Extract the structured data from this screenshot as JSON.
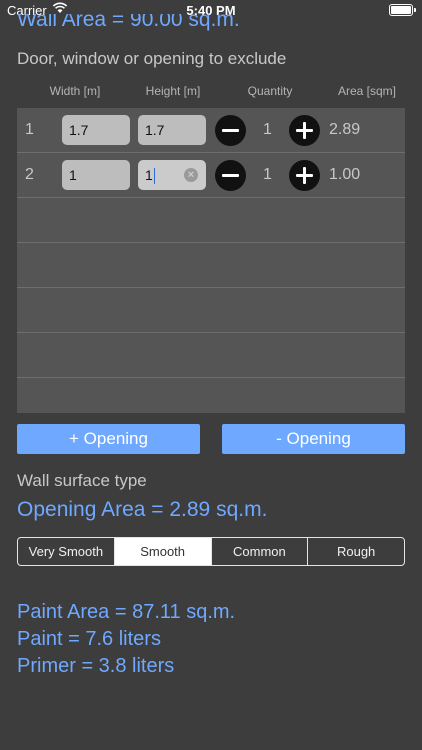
{
  "status_bar": {
    "carrier": "Carrier",
    "time": "5:40 PM"
  },
  "wall_area": "Wall Area = 90.00 sq.m.",
  "openings_section": {
    "title": "Door, window or opening to exclude",
    "columns": [
      "Width [m]",
      "Height [m]",
      "Quantity",
      "Area [sqm]"
    ],
    "rows": [
      {
        "num": "1",
        "width": "1.7",
        "height": "1.7",
        "quantity": "1",
        "area": "2.89"
      },
      {
        "num": "2",
        "width": "1",
        "height": "1",
        "quantity": "1",
        "area": "1.00"
      }
    ]
  },
  "buttons": {
    "add_opening": "+ Opening",
    "remove_opening": "- Opening"
  },
  "surface_label": "Wall surface type",
  "opening_area": "Opening Area = 2.89 sq.m.",
  "surface_types": [
    "Very Smooth",
    "Smooth",
    "Common",
    "Rough"
  ],
  "selected_surface": "Smooth",
  "results": {
    "paint_area": "Paint Area = 87.11 sq.m.",
    "paint": "Paint = 7.6 liters",
    "primer": "Primer = 3.8 liters"
  }
}
